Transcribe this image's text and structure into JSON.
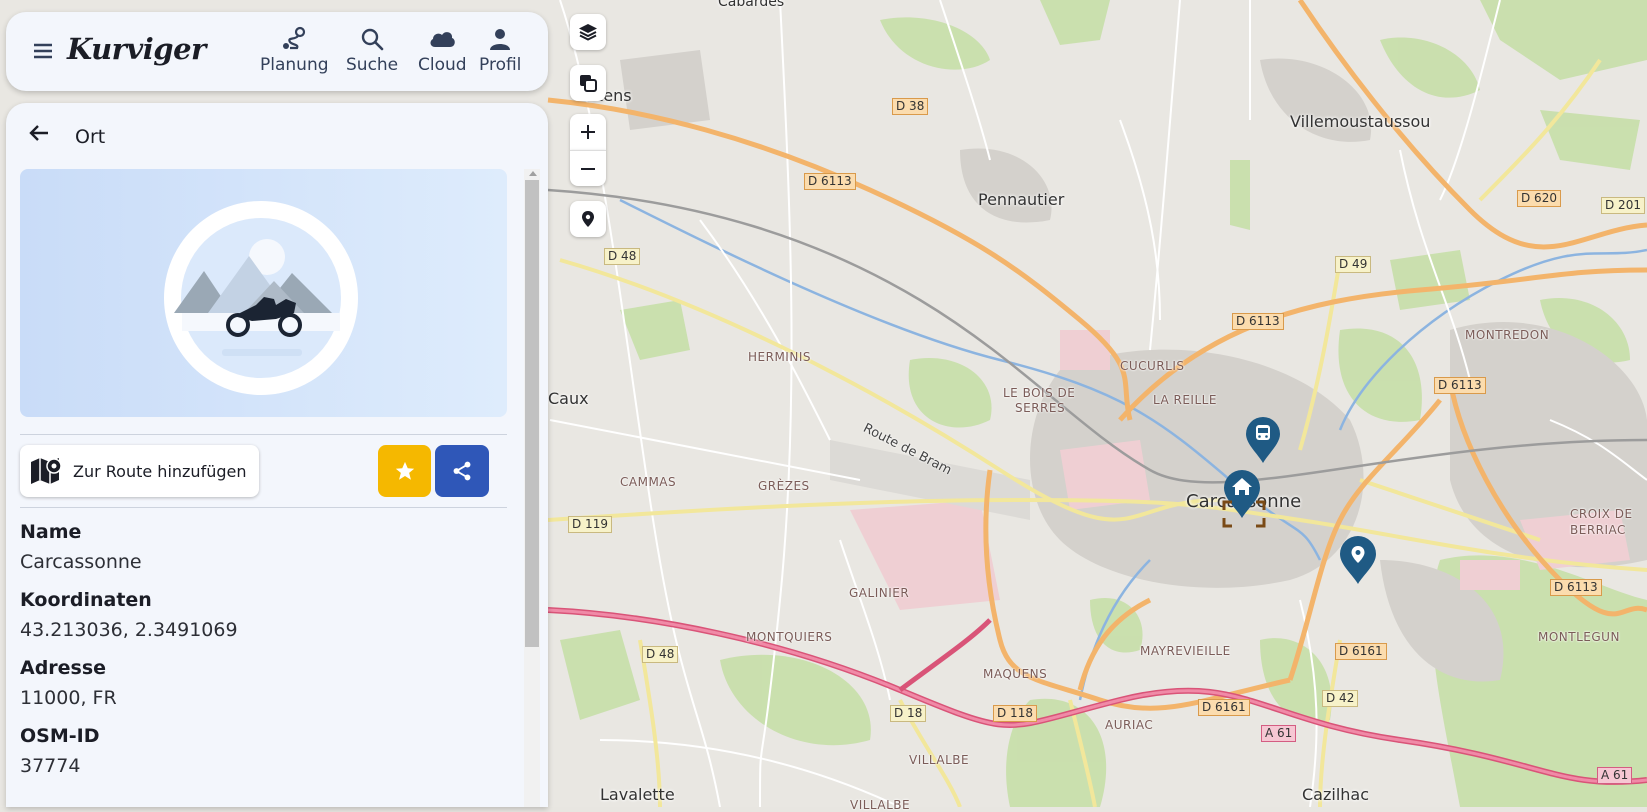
{
  "app": {
    "logo_text": "Kurviger"
  },
  "nav": {
    "planning": "Planung",
    "search": "Suche",
    "cloud": "Cloud",
    "profile": "Profil"
  },
  "panel": {
    "title": "Ort",
    "add_to_route": "Zur Route hinzufügen",
    "fields": {
      "name_label": "Name",
      "name_value": "Carcassonne",
      "coords_label": "Koordinaten",
      "coords_value": "43.213036, 2.3491069",
      "address_label": "Adresse",
      "address_value": "11000, FR",
      "osm_label": "OSM-ID",
      "osm_value": "37774"
    },
    "colors": {
      "favorite": "#f5b800",
      "share": "#2f57b8"
    }
  },
  "map": {
    "places": {
      "carcassonne": "Carcassonne",
      "pennautier": "Pennautier",
      "villemoustaussou": "Villemoustaussou",
      "lavalette": "Lavalette",
      "cazilhac": "Cazilhac",
      "ezens": "ezens",
      "caux": "Caux",
      "cabardes": "Cabardès"
    },
    "districts": {
      "herminis": "HERMINIS",
      "cucurlis": "CUCURLIS",
      "la_reille": "LA REILLE",
      "le_bois": "LE BOIS DE",
      "serres": "SERRES",
      "montredon": "MONTREDON",
      "cammas": "CAMMAS",
      "grezes": "GRÈZES",
      "galinier": "GALINIER",
      "montquiers": "MONTQUIERS",
      "maquens": "MAQUENS",
      "mayrevieille": "MAYREVIEILLE",
      "croix_de": "CROIX DE",
      "berriac": "BERRIAC",
      "montlegun": "MONTLEGUN",
      "auriac": "AURIAC",
      "villalbe": "VILLALBE",
      "villalbe2": "VILLALBE"
    },
    "street": "Route de Bram",
    "roads": {
      "d38": "D 38",
      "d6113a": "D 6113",
      "d6113b": "D 6113",
      "d6113c": "D 6113",
      "d6113d": "D 6113",
      "d620": "D 620",
      "d201": "D 201",
      "d48a": "D 48",
      "d48b": "D 48",
      "d49": "D 49",
      "d119": "D 119",
      "d18": "D 18",
      "d118": "D 118",
      "d6161a": "D 6161",
      "d6161b": "D 6161",
      "d42": "D 42",
      "a61a": "A 61",
      "a61b": "A 61"
    }
  }
}
